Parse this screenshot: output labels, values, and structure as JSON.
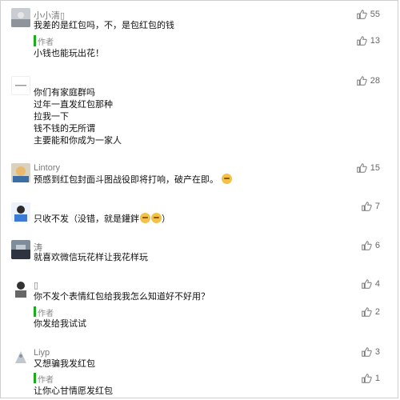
{
  "comments": [
    {
      "username": "小小清▯",
      "text": "我差的是红包吗，不，是包红包的钱",
      "likes": "55",
      "reply": {
        "label": "作者",
        "text": "小钱也能玩出花！",
        "likes": "13"
      }
    },
    {
      "username": "",
      "text": "你们有家庭群吗\n过年一直发红包那种\n拉我一下\n钱不钱的无所谓\n主要能和你成为一家人",
      "likes": "28"
    },
    {
      "username": "Lintory",
      "text": "预感到红包封面斗图战役即将打响，破产在即。",
      "likes": "15"
    },
    {
      "username": "",
      "text_a": "只收不发（没错，就是鑵鉡",
      "text_b": "）",
      "likes": "7"
    },
    {
      "username": "涛",
      "text": "就喜欢微信玩花样让我花样玩",
      "likes": "6"
    },
    {
      "username": "▯",
      "text": "你不发个表情红包给我我怎么知道好不好用？",
      "likes": "4",
      "reply": {
        "label": "作者",
        "text": "你发给我试试",
        "likes": "2"
      }
    },
    {
      "username": "Liyp",
      "text": "又想骗我发红包",
      "likes": "3",
      "reply": {
        "label": "作者",
        "text": "让你心甘情愿发红包",
        "likes": "1"
      }
    }
  ],
  "colors": {
    "accent": "#1aad19",
    "username": "#7a7a7a",
    "text": "#111111"
  },
  "icons": {
    "like": "thumbs-up-icon",
    "emoji": "grimace-emoji-icon"
  }
}
